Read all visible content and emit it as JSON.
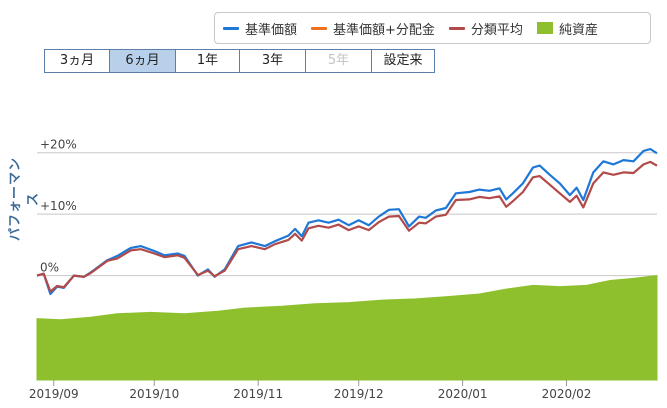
{
  "legend": [
    {
      "label": "基準価額",
      "color": "#1e78d8",
      "kind": "line"
    },
    {
      "label": "基準価額+分配金",
      "color": "#f07020",
      "kind": "line"
    },
    {
      "label": "分類平均",
      "color": "#b24a4a",
      "kind": "line"
    },
    {
      "label": "純資産",
      "color": "#8ebf2d",
      "kind": "box"
    }
  ],
  "periods": [
    {
      "label": "3ヵ月",
      "state": "normal"
    },
    {
      "label": "6ヵ月",
      "state": "active"
    },
    {
      "label": "1年",
      "state": "normal"
    },
    {
      "label": "3年",
      "state": "normal"
    },
    {
      "label": "5年",
      "state": "disabled"
    },
    {
      "label": "設定来",
      "state": "normal"
    }
  ],
  "chart_data": {
    "type": "line",
    "ylabel": "パフォーマンス",
    "ytick_labels": [
      "+20%",
      "+10%",
      "0%"
    ],
    "yticks": [
      20,
      10,
      0
    ],
    "ylim": [
      -17,
      25
    ],
    "xlim": [
      "2019-08-27",
      "2020-02-28"
    ],
    "xtick_labels": [
      "2019/09",
      "2019/10",
      "2019/11",
      "2019/12",
      "2020/01",
      "2020/02"
    ],
    "xticks": [
      "2019-09-01",
      "2019-10-01",
      "2019-11-01",
      "2019-12-01",
      "2020-01-01",
      "2020-02-01"
    ],
    "colors": {
      "base": "#1e78d8",
      "category_avg": "#b24a4a",
      "net_assets": "#8ebf2d",
      "grid": "#c8c8c8"
    },
    "series": [
      {
        "name": "基準価額",
        "key": "base",
        "points": [
          [
            "2019-08-27",
            0.0
          ],
          [
            "2019-08-29",
            0.3
          ],
          [
            "2019-08-31",
            -3.0
          ],
          [
            "2019-09-02",
            -1.8
          ],
          [
            "2019-09-04",
            -2.0
          ],
          [
            "2019-09-07",
            0.0
          ],
          [
            "2019-09-10",
            -0.2
          ],
          [
            "2019-09-12",
            0.5
          ],
          [
            "2019-09-17",
            2.5
          ],
          [
            "2019-09-20",
            3.2
          ],
          [
            "2019-09-24",
            4.5
          ],
          [
            "2019-09-27",
            4.8
          ],
          [
            "2019-10-01",
            4.0
          ],
          [
            "2019-10-04",
            3.3
          ],
          [
            "2019-10-08",
            3.6
          ],
          [
            "2019-10-10",
            3.2
          ],
          [
            "2019-10-14",
            0.0
          ],
          [
            "2019-10-17",
            1.0
          ],
          [
            "2019-10-19",
            -0.2
          ],
          [
            "2019-10-22",
            1.0
          ],
          [
            "2019-10-26",
            4.8
          ],
          [
            "2019-10-30",
            5.4
          ],
          [
            "2019-11-03",
            4.8
          ],
          [
            "2019-11-06",
            5.6
          ],
          [
            "2019-11-10",
            6.5
          ],
          [
            "2019-11-12",
            7.6
          ],
          [
            "2019-11-14",
            6.4
          ],
          [
            "2019-11-16",
            8.6
          ],
          [
            "2019-11-19",
            9.0
          ],
          [
            "2019-11-22",
            8.6
          ],
          [
            "2019-11-25",
            9.1
          ],
          [
            "2019-11-28",
            8.2
          ],
          [
            "2019-12-01",
            9.0
          ],
          [
            "2019-12-04",
            8.2
          ],
          [
            "2019-12-07",
            9.6
          ],
          [
            "2019-12-10",
            10.7
          ],
          [
            "2019-12-13",
            10.8
          ],
          [
            "2019-12-16",
            8.0
          ],
          [
            "2019-12-19",
            9.6
          ],
          [
            "2019-12-21",
            9.4
          ],
          [
            "2019-12-24",
            10.6
          ],
          [
            "2019-12-27",
            11.0
          ],
          [
            "2019-12-30",
            13.4
          ],
          [
            "2020-01-03",
            13.6
          ],
          [
            "2020-01-06",
            14.0
          ],
          [
            "2020-01-09",
            13.8
          ],
          [
            "2020-01-12",
            14.2
          ],
          [
            "2020-01-14",
            12.4
          ],
          [
            "2020-01-16",
            13.4
          ],
          [
            "2020-01-19",
            15.0
          ],
          [
            "2020-01-22",
            17.6
          ],
          [
            "2020-01-24",
            17.9
          ],
          [
            "2020-01-27",
            16.4
          ],
          [
            "2020-01-30",
            15.0
          ],
          [
            "2020-02-02",
            13.1
          ],
          [
            "2020-02-04",
            14.3
          ],
          [
            "2020-02-06",
            12.3
          ],
          [
            "2020-02-09",
            16.8
          ],
          [
            "2020-02-12",
            18.6
          ],
          [
            "2020-02-15",
            18.1
          ],
          [
            "2020-02-18",
            18.8
          ],
          [
            "2020-02-21",
            18.6
          ],
          [
            "2020-02-24",
            20.3
          ],
          [
            "2020-02-26",
            20.6
          ],
          [
            "2020-02-28",
            19.9
          ]
        ]
      },
      {
        "name": "分類平均",
        "key": "category_avg",
        "points": [
          [
            "2019-08-27",
            0.0
          ],
          [
            "2019-08-29",
            0.3
          ],
          [
            "2019-08-31",
            -2.6
          ],
          [
            "2019-09-02",
            -1.7
          ],
          [
            "2019-09-04",
            -1.9
          ],
          [
            "2019-09-07",
            0.0
          ],
          [
            "2019-09-10",
            -0.2
          ],
          [
            "2019-09-12",
            0.4
          ],
          [
            "2019-09-17",
            2.4
          ],
          [
            "2019-09-20",
            2.8
          ],
          [
            "2019-09-24",
            4.1
          ],
          [
            "2019-09-27",
            4.3
          ],
          [
            "2019-10-01",
            3.6
          ],
          [
            "2019-10-04",
            3.0
          ],
          [
            "2019-10-08",
            3.3
          ],
          [
            "2019-10-10",
            2.9
          ],
          [
            "2019-10-14",
            0.1
          ],
          [
            "2019-10-17",
            0.8
          ],
          [
            "2019-10-19",
            -0.1
          ],
          [
            "2019-10-22",
            0.8
          ],
          [
            "2019-10-26",
            4.3
          ],
          [
            "2019-10-30",
            4.8
          ],
          [
            "2019-11-03",
            4.3
          ],
          [
            "2019-11-06",
            5.1
          ],
          [
            "2019-11-10",
            5.8
          ],
          [
            "2019-11-12",
            6.8
          ],
          [
            "2019-11-14",
            5.7
          ],
          [
            "2019-11-16",
            7.7
          ],
          [
            "2019-11-19",
            8.1
          ],
          [
            "2019-11-22",
            7.8
          ],
          [
            "2019-11-25",
            8.3
          ],
          [
            "2019-11-28",
            7.4
          ],
          [
            "2019-12-01",
            8.0
          ],
          [
            "2019-12-04",
            7.4
          ],
          [
            "2019-12-07",
            8.7
          ],
          [
            "2019-12-10",
            9.6
          ],
          [
            "2019-12-13",
            9.7
          ],
          [
            "2019-12-16",
            7.3
          ],
          [
            "2019-12-19",
            8.6
          ],
          [
            "2019-12-21",
            8.5
          ],
          [
            "2019-12-24",
            9.6
          ],
          [
            "2019-12-27",
            9.9
          ],
          [
            "2019-12-30",
            12.3
          ],
          [
            "2020-01-03",
            12.4
          ],
          [
            "2020-01-06",
            12.8
          ],
          [
            "2020-01-09",
            12.6
          ],
          [
            "2020-01-12",
            12.9
          ],
          [
            "2020-01-14",
            11.2
          ],
          [
            "2020-01-16",
            12.1
          ],
          [
            "2020-01-19",
            13.6
          ],
          [
            "2020-01-22",
            16.0
          ],
          [
            "2020-01-24",
            16.2
          ],
          [
            "2020-01-27",
            14.8
          ],
          [
            "2020-01-30",
            13.4
          ],
          [
            "2020-02-02",
            12.0
          ],
          [
            "2020-02-04",
            13.0
          ],
          [
            "2020-02-06",
            11.1
          ],
          [
            "2020-02-09",
            15.0
          ],
          [
            "2020-02-12",
            16.8
          ],
          [
            "2020-02-15",
            16.4
          ],
          [
            "2020-02-18",
            16.8
          ],
          [
            "2020-02-21",
            16.7
          ],
          [
            "2020-02-24",
            18.1
          ],
          [
            "2020-02-26",
            18.5
          ],
          [
            "2020-02-28",
            17.9
          ]
        ]
      },
      {
        "name": "純資産",
        "key": "net_assets",
        "area": true,
        "points": [
          [
            "2019-08-27",
            -7.0
          ],
          [
            "2019-09-03",
            -7.2
          ],
          [
            "2019-09-12",
            -6.8
          ],
          [
            "2019-09-20",
            -6.2
          ],
          [
            "2019-09-30",
            -6.0
          ],
          [
            "2019-10-10",
            -6.2
          ],
          [
            "2019-10-20",
            -5.8
          ],
          [
            "2019-10-28",
            -5.3
          ],
          [
            "2019-11-08",
            -5.0
          ],
          [
            "2019-11-18",
            -4.6
          ],
          [
            "2019-11-28",
            -4.4
          ],
          [
            "2019-12-08",
            -4.0
          ],
          [
            "2019-12-18",
            -3.8
          ],
          [
            "2019-12-28",
            -3.4
          ],
          [
            "2020-01-06",
            -3.0
          ],
          [
            "2020-01-14",
            -2.2
          ],
          [
            "2020-01-22",
            -1.6
          ],
          [
            "2020-01-30",
            -1.8
          ],
          [
            "2020-02-07",
            -1.6
          ],
          [
            "2020-02-14",
            -0.8
          ],
          [
            "2020-02-22",
            -0.4
          ],
          [
            "2020-02-28",
            0.0
          ]
        ]
      }
    ]
  }
}
